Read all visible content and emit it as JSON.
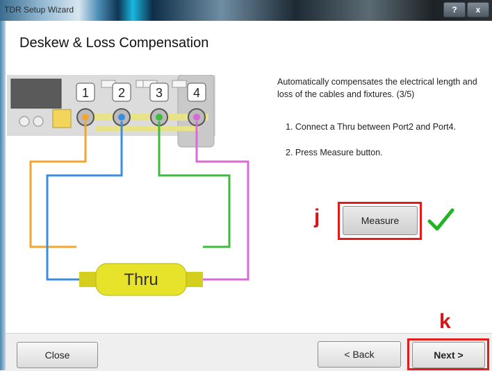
{
  "window": {
    "title": "TDR Setup Wizard",
    "help_label": "?",
    "close_label": "x"
  },
  "header": {
    "title": "Deskew & Loss Compensation"
  },
  "instructions": {
    "description": "Automatically compensates the electrical length and loss of the cables and fixtures.  (3/5)",
    "step1": "1. Connect a Thru between Port2 and Port4.",
    "step2": "2. Press Measure button."
  },
  "diagram": {
    "ports": [
      "1",
      "2",
      "3",
      "4"
    ],
    "thru_label": "Thru",
    "cable_colors": {
      "port1": "#f0a630",
      "port2": "#3a8ee0",
      "port3": "#3dbb3d",
      "port4": "#d86ad8"
    }
  },
  "annotations": {
    "marker_j": "j",
    "marker_k": "k",
    "highlight_color": "#e31b1b"
  },
  "buttons": {
    "measure": "Measure",
    "close": "Close",
    "back": "< Back",
    "next": "Next >"
  },
  "status": {
    "measure_done_icon": "checkmark-icon",
    "check_color": "#22b422"
  }
}
